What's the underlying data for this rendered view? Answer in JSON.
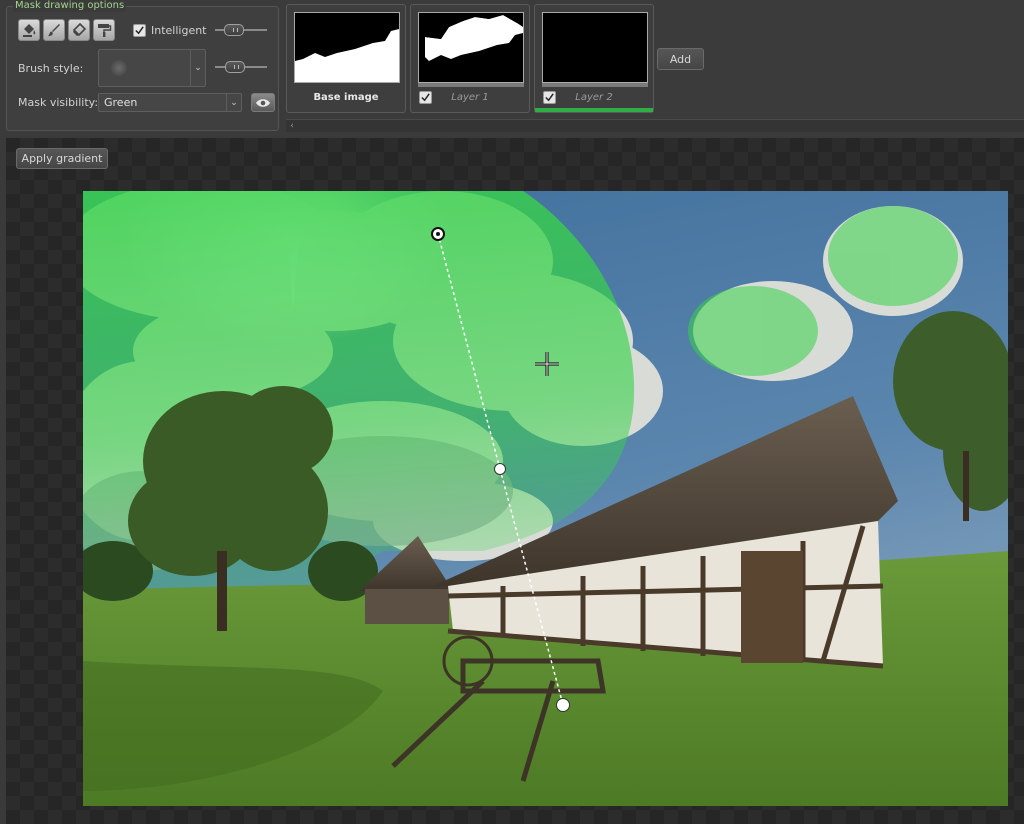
{
  "options": {
    "title": "Mask drawing options",
    "tools": [
      {
        "name": "bucket-fill-icon"
      },
      {
        "name": "brush-icon"
      },
      {
        "name": "eraser-icon"
      },
      {
        "name": "roller-icon"
      }
    ],
    "intelligent_label": "Intelligent",
    "intelligent_checked": true,
    "brush_style_label": "Brush style:",
    "mask_visibility_label": "Mask visibility:",
    "mask_visibility_value": "Green"
  },
  "layers": [
    {
      "name": "Base image",
      "checkbox": false,
      "selected": false
    },
    {
      "name": "Layer 1",
      "checkbox": true,
      "selected": false
    },
    {
      "name": "Layer 2",
      "checkbox": true,
      "selected": true
    }
  ],
  "add_button": "Add",
  "apply_gradient_button": "Apply gradient",
  "colors": {
    "accent_green": "#2fae46",
    "title_green": "#a4d48c",
    "mask_overlay": "#37d24a"
  }
}
